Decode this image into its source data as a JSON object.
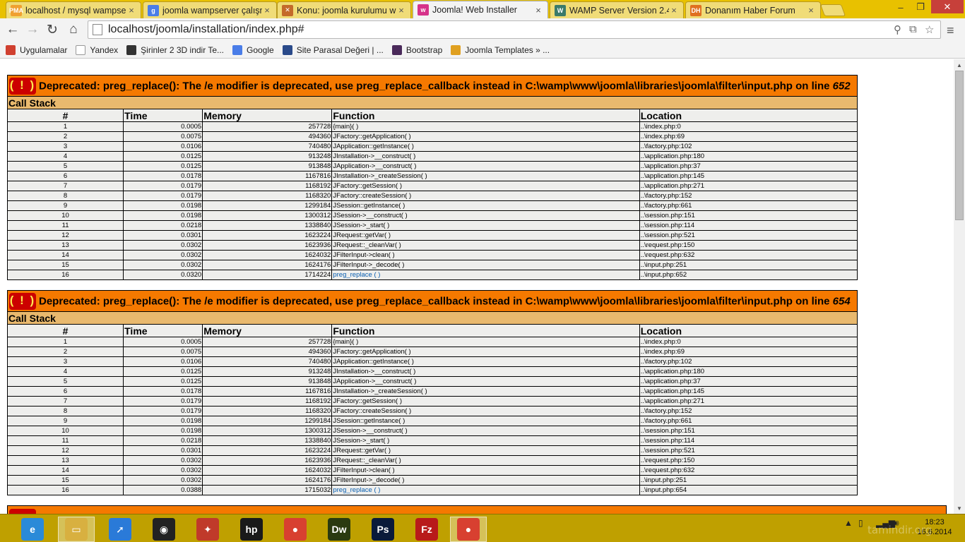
{
  "browser": {
    "tabs": [
      {
        "title": "localhost / mysql wampse",
        "favicon": "phpmyadmin-icon",
        "color": "#f0a030",
        "label": "PMA"
      },
      {
        "title": "joomla wampserver çalışm",
        "favicon": "google-icon",
        "color": "#4a7de8",
        "label": "g"
      },
      {
        "title": "Konu: joomla kurulumu w",
        "favicon": "puzzle-icon",
        "color": "#c46a2a",
        "label": "✕"
      },
      {
        "title": "Joomla! Web Installer",
        "favicon": "web-icon",
        "color": "#d6338a",
        "label": "w"
      },
      {
        "title": "WAMP Server Version 2.4",
        "favicon": "wamp-icon",
        "color": "#3a7a6a",
        "label": "W"
      },
      {
        "title": "Donanım Haber Forum",
        "favicon": "dh-icon",
        "color": "#e07020",
        "label": "DH"
      }
    ],
    "active_tab": 3,
    "url": "localhost/joomla/installation/index.php#",
    "bookmarks": [
      {
        "label": "Uygulamalar",
        "icon": "apps-grid-icon",
        "color": "#d04030"
      },
      {
        "label": "Yandex",
        "icon": "page-icon",
        "color": "#ffffff"
      },
      {
        "label": "Şirinler 2 3D indir Te...",
        "icon": "film-icon",
        "color": "#333333"
      },
      {
        "label": "Google",
        "icon": "google-icon",
        "color": "#4a7de8"
      },
      {
        "label": "Site Parasal Değeri | ...",
        "icon": "paw-icon",
        "color": "#2a4a8a"
      },
      {
        "label": "Bootstrap",
        "icon": "bootstrap-icon",
        "color": "#4a2a5a"
      },
      {
        "label": "Joomla Templates » ...",
        "icon": "joomla-icon",
        "color": "#e0a020"
      }
    ]
  },
  "errors": [
    {
      "bang": "( ! )",
      "message": "Deprecated: preg_replace(): The /e modifier is deprecated, use preg_replace_callback instead in C:\\wamp\\www\\joomla\\libraries\\joomla\\filter\\input.php on line ",
      "line": "652",
      "call_stack_label": "Call Stack",
      "headers": [
        "#",
        "Time",
        "Memory",
        "Function",
        "Location"
      ],
      "rows": [
        [
          "1",
          "0.0005",
          "257728",
          "{main}( )",
          "..\\index.php:0"
        ],
        [
          "2",
          "0.0075",
          "494360",
          "JFactory::getApplication( )",
          "..\\index.php:69"
        ],
        [
          "3",
          "0.0106",
          "740480",
          "JApplication::getInstance( )",
          "..\\factory.php:102"
        ],
        [
          "4",
          "0.0125",
          "913248",
          "JInstallation->__construct( )",
          "..\\application.php:180"
        ],
        [
          "5",
          "0.0125",
          "913848",
          "JApplication->__construct( )",
          "..\\application.php:37"
        ],
        [
          "6",
          "0.0178",
          "1167816",
          "JInstallation->_createSession( )",
          "..\\application.php:145"
        ],
        [
          "7",
          "0.0179",
          "1168192",
          "JFactory::getSession( )",
          "..\\application.php:271"
        ],
        [
          "8",
          "0.0179",
          "1168320",
          "JFactory::createSession( )",
          "..\\factory.php:152"
        ],
        [
          "9",
          "0.0198",
          "1299184",
          "JSession::getInstance( )",
          "..\\factory.php:661"
        ],
        [
          "10",
          "0.0198",
          "1300312",
          "JSession->__construct( )",
          "..\\session.php:151"
        ],
        [
          "11",
          "0.0218",
          "1338840",
          "JSession->_start( )",
          "..\\session.php:114"
        ],
        [
          "12",
          "0.0301",
          "1623224",
          "JRequest::getVar( )",
          "..\\session.php:521"
        ],
        [
          "13",
          "0.0302",
          "1623936",
          "JRequest::_cleanVar( )",
          "..\\request.php:150"
        ],
        [
          "14",
          "0.0302",
          "1624032",
          "JFilterInput->clean( )",
          "..\\request.php:632"
        ],
        [
          "15",
          "0.0302",
          "1624176",
          "JFilterInput->_decode( )",
          "..\\input.php:251"
        ],
        [
          "16",
          "0.0320",
          "1714224",
          "preg_replace ( )",
          "..\\input.php:652"
        ]
      ]
    },
    {
      "bang": "( ! )",
      "message": "Deprecated: preg_replace(): The /e modifier is deprecated, use preg_replace_callback instead in C:\\wamp\\www\\joomla\\libraries\\joomla\\filter\\input.php on line ",
      "line": "654",
      "call_stack_label": "Call Stack",
      "headers": [
        "#",
        "Time",
        "Memory",
        "Function",
        "Location"
      ],
      "rows": [
        [
          "1",
          "0.0005",
          "257728",
          "{main}( )",
          "..\\index.php:0"
        ],
        [
          "2",
          "0.0075",
          "494360",
          "JFactory::getApplication( )",
          "..\\index.php:69"
        ],
        [
          "3",
          "0.0106",
          "740480",
          "JApplication::getInstance( )",
          "..\\factory.php:102"
        ],
        [
          "4",
          "0.0125",
          "913248",
          "JInstallation->__construct( )",
          "..\\application.php:180"
        ],
        [
          "5",
          "0.0125",
          "913848",
          "JApplication->__construct( )",
          "..\\application.php:37"
        ],
        [
          "6",
          "0.0178",
          "1167816",
          "JInstallation->_createSession( )",
          "..\\application.php:145"
        ],
        [
          "7",
          "0.0179",
          "1168192",
          "JFactory::getSession( )",
          "..\\application.php:271"
        ],
        [
          "8",
          "0.0179",
          "1168320",
          "JFactory::createSession( )",
          "..\\factory.php:152"
        ],
        [
          "9",
          "0.0198",
          "1299184",
          "JSession::getInstance( )",
          "..\\factory.php:661"
        ],
        [
          "10",
          "0.0198",
          "1300312",
          "JSession->__construct( )",
          "..\\session.php:151"
        ],
        [
          "11",
          "0.0218",
          "1338840",
          "JSession->_start( )",
          "..\\session.php:114"
        ],
        [
          "12",
          "0.0301",
          "1623224",
          "JRequest::getVar( )",
          "..\\session.php:521"
        ],
        [
          "13",
          "0.0302",
          "1623936",
          "JRequest::_cleanVar( )",
          "..\\request.php:150"
        ],
        [
          "14",
          "0.0302",
          "1624032",
          "JFilterInput->clean( )",
          "..\\request.php:632"
        ],
        [
          "15",
          "0.0302",
          "1624176",
          "JFilterInput->_decode( )",
          "..\\input.php:251"
        ],
        [
          "16",
          "0.0388",
          "1715032",
          "preg_replace ( )",
          "..\\input.php:654"
        ]
      ]
    }
  ],
  "taskbar": {
    "apps": [
      {
        "name": "internet-explorer-icon",
        "label": "e",
        "color": "#2a8ad8"
      },
      {
        "name": "file-explorer-icon",
        "label": "▭",
        "color": "#d8b040",
        "active": true
      },
      {
        "name": "rocket-app-icon",
        "label": "➚",
        "color": "#2a7ad8"
      },
      {
        "name": "camera-app-icon",
        "label": "◉",
        "color": "#222222"
      },
      {
        "name": "puzzle-app-icon",
        "label": "✦",
        "color": "#c03a2a"
      },
      {
        "name": "hp-icon",
        "label": "hp",
        "color": "#1a1a1a"
      },
      {
        "name": "chrome-icon",
        "label": "●",
        "color": "#d84030"
      },
      {
        "name": "dreamweaver-icon",
        "label": "Dw",
        "color": "#2a3a10"
      },
      {
        "name": "photoshop-icon",
        "label": "Ps",
        "color": "#0a1a3a"
      },
      {
        "name": "filezilla-icon",
        "label": "Fz",
        "color": "#b81a1a"
      },
      {
        "name": "chrome-active-icon",
        "label": "●",
        "color": "#d84030",
        "active": true
      }
    ],
    "time": "18:23",
    "date": "16.6.2014",
    "watermark": "tamindir.org"
  }
}
